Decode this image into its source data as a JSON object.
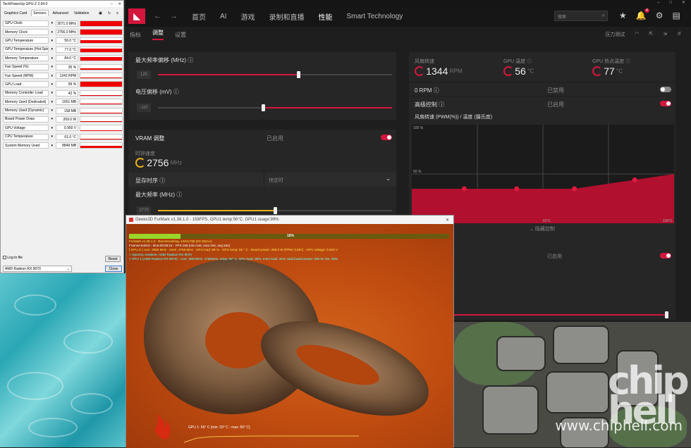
{
  "desktop": {
    "watermark_logo": "chip hell",
    "watermark_url": "www.chiphell.com"
  },
  "gpuz": {
    "title": "TechPowerUp GPU-Z 2.64.0",
    "tabs": [
      "Graphics Card",
      "Sensors",
      "Advanced",
      "Validation"
    ],
    "active_tab": "Sensors",
    "sensors": [
      {
        "label": "GPU Clock",
        "value": "3071.0 MHz",
        "level": 1.0
      },
      {
        "label": "Memory Clock",
        "value": "2756.0 MHz",
        "level": 1.0
      },
      {
        "label": "GPU Temperature",
        "value": "56.0 °C",
        "level": 0.6
      },
      {
        "label": "GPU Temperature (Hot Spot)",
        "value": "77.0 °C",
        "level": 0.75
      },
      {
        "label": "Memory Temperature",
        "value": "84.0 °C",
        "level": 0.8
      },
      {
        "label": "Fan Speed (%)",
        "value": "35 %",
        "level": 0.2
      },
      {
        "label": "Fan Speed (RPM)",
        "value": "1342 RPM",
        "level": 0.2
      },
      {
        "label": "GPU Load",
        "value": "99 %",
        "level": 1.0
      },
      {
        "label": "Memory Controller Load",
        "value": "42 %",
        "level": 0.15
      },
      {
        "label": "Memory Used (Dedicated)",
        "value": "1651 MB",
        "level": 0.2
      },
      {
        "label": "Memory Used (Dynamic)",
        "value": "158 MB",
        "level": 0.05
      },
      {
        "label": "Board Power Draw",
        "value": "269.0 W",
        "level": 0.1
      },
      {
        "label": "GPU Voltage",
        "value": "0.950 V",
        "level": 0.05
      },
      {
        "label": "CPU Temperature",
        "value": "61.0 °C",
        "level": 0.1
      },
      {
        "label": "System Memory Used",
        "value": "8849 MB",
        "level": 0.4
      }
    ],
    "log_label": "Log to file",
    "reset_label": "Reset",
    "gpu_select": "AMD Radeon RX 9070",
    "close_label": "Close"
  },
  "amd": {
    "nav": [
      "首页",
      "AI",
      "游戏",
      "录制和直播",
      "性能",
      "Smart Technology"
    ],
    "nav_active": "性能",
    "search_placeholder": "搜索",
    "notification_count": "4",
    "subtabs": [
      "指标",
      "调整",
      "设置"
    ],
    "subtab_active": "调整",
    "stress_test": "压力测试",
    "max_freq_offset_label": "最大频率偏移 (MHz)",
    "max_freq_offset_value": "120",
    "max_freq_offset_level": 0.6,
    "voltage_offset_label": "电压偏移 (mV)",
    "voltage_offset_value": "-110",
    "voltage_offset_level": 0.45,
    "vram_title": "VRAM 调整",
    "enabled": "已启用",
    "disabled": "已禁用",
    "clock_speed_label": "时钟速度",
    "clock_speed_value": "2756",
    "clock_speed_unit": "MHz",
    "mem_timing_label": "显存时序",
    "mem_timing_value": "快定时",
    "vram_max_freq_label": "最大频率 (MHz)",
    "vram_max_freq_value": "2770",
    "vram_max_freq_level": 0.5,
    "fan_speed_label": "风扇转速",
    "fan_speed_value": "1344",
    "fan_speed_unit": "RPM",
    "gpu_temp_label": "GPU 温度",
    "gpu_temp_value": "56",
    "gpu_hotspot_label": "GPU 热点温度",
    "gpu_hotspot_value": "77",
    "temp_unit": "°C",
    "zero_rpm_label": "0 RPM",
    "advanced_control_label": "高级控制",
    "fan_curve_label": "风扇转速 (PWM(%)) / 温度 (摄氏度)",
    "fan_curve_y_top": "100 %",
    "fan_curve_y_mid": "50 %",
    "fan_curve_x_mid": "62℃",
    "fan_curve_x_max": "100℃",
    "hide_control_label": "隐藏控制",
    "accent": "#d4163c"
  },
  "chart_data": {
    "type": "area",
    "title": "风扇转速 (PWM(%)) / 温度 (摄氏度)",
    "x": [
      0,
      20,
      40,
      62,
      100
    ],
    "series": [
      {
        "values": [
          35,
          35,
          35,
          35,
          50
        ]
      }
    ],
    "ylim": [
      0,
      100
    ],
    "xlim": [
      0,
      100
    ],
    "ytick_labels": [
      "50 %",
      "100 %"
    ],
    "xtick_labels": [
      "62℃",
      "100℃"
    ],
    "grid": true
  },
  "furmark": {
    "title": "Geeks3D FurMark v1.38.1.0 - 158FPS, GPU1 temp:56°C, GPU1 usage:99%",
    "progress_label": "16%",
    "progress": 0.16,
    "line1": "FurMark v1.38.1.0 - Benchmarking, 1024x768 (8X MSAA)",
    "line2": "Frames:54818 - time:00:05:24 - FPS:158 (min:146, max:194, avg:161)",
    "line3": "[ GPU-Z ] core: 3055 MHz - mem: 2756 MHz - GPU load: 99 % - GPU temp: 56 ° C - Board power: 269.0 W (PPW: 0.587) - GPU voltage: 0.933 V",
    "line4": "> OpenGL renderer: AMD Radeon RX 9070",
    "line5": "> GPU 1 (AMD Radeon RX 9070) - core: 3057MHz, 2756MHz, temp: 56° C, GPU load: 98%, mem load: 44%, total board power: 269 W, fan: 35%",
    "temp_graph_label": "GPU 1: 56° C (min: 33° C - max: 56° C)"
  }
}
